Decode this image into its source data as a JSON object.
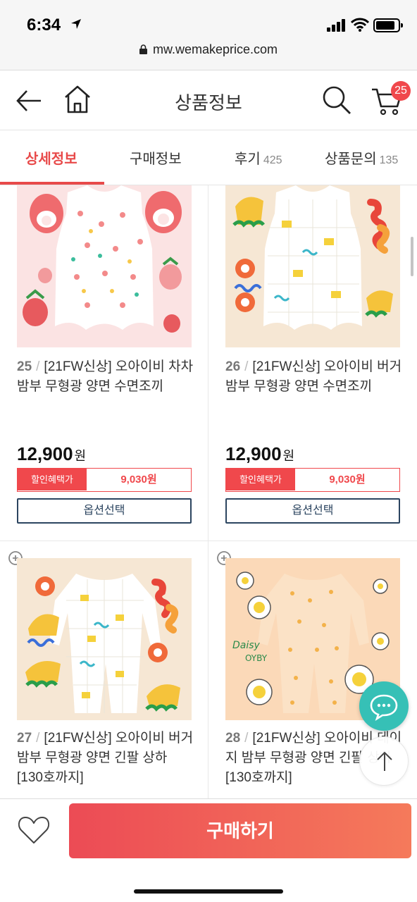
{
  "status_bar": {
    "time": "6:34",
    "url": "mw.wemakeprice.com"
  },
  "header": {
    "title": "상품정보",
    "cart_count": "25"
  },
  "tabs": [
    {
      "label": "상세정보",
      "count": ""
    },
    {
      "label": "구매정보",
      "count": ""
    },
    {
      "label": "후기",
      "count": "425"
    },
    {
      "label": "상품문의",
      "count": "135"
    }
  ],
  "products": [
    {
      "num": "25",
      "name": "[21FW신상] 오아이비 차차 밤부 무형광 양면 수면조끼",
      "price": "12,900",
      "won": "원",
      "disc_label": "할인혜택가",
      "disc_price": "9,030원",
      "option_label": "옵션선택"
    },
    {
      "num": "26",
      "name": "[21FW신상] 오아이비 버거 밤부 무형광 양면 수면조끼",
      "price": "12,900",
      "won": "원",
      "disc_label": "할인혜택가",
      "disc_price": "9,030원",
      "option_label": "옵션선택"
    },
    {
      "num": "27",
      "name": "[21FW신상] 오아이비 버거 밤부 무형광 양면 긴팔 상하 [130호까지]"
    },
    {
      "num": "28",
      "name": "[21FW신상] 오아이비 데이지 밤부 무형광 양면 긴팔 상하 [130호까지]"
    }
  ],
  "image_text": {
    "daisy": "Daisy",
    "oyby": "OYBY"
  },
  "bottom": {
    "buy_label": "구매하기"
  },
  "colors": {
    "accent": "#f0484c",
    "chat": "#36c0b6",
    "option_border": "#2c4560"
  }
}
